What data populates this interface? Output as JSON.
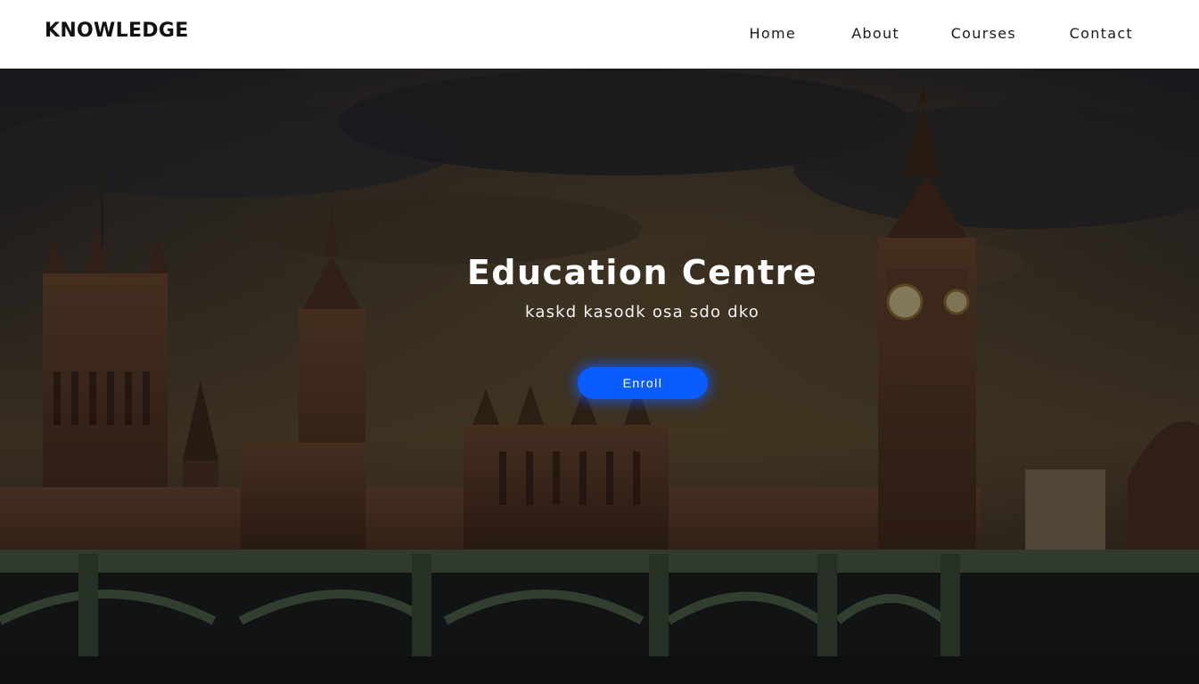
{
  "navbar": {
    "logo": "KNOWLEDGE",
    "links": [
      "Home",
      "About",
      "Courses",
      "Contact"
    ]
  },
  "hero": {
    "title": "Education Centre",
    "subtitle": "kaskd kasodk osa sdo dko",
    "button_label": "Enroll",
    "background_description_colors": {
      "sky_dark": "#2b2d33",
      "sky_warm": "#5a4a35",
      "building": "#5b3d2c",
      "bridge": "#3c4a3c",
      "button": "#0a5cff"
    }
  }
}
